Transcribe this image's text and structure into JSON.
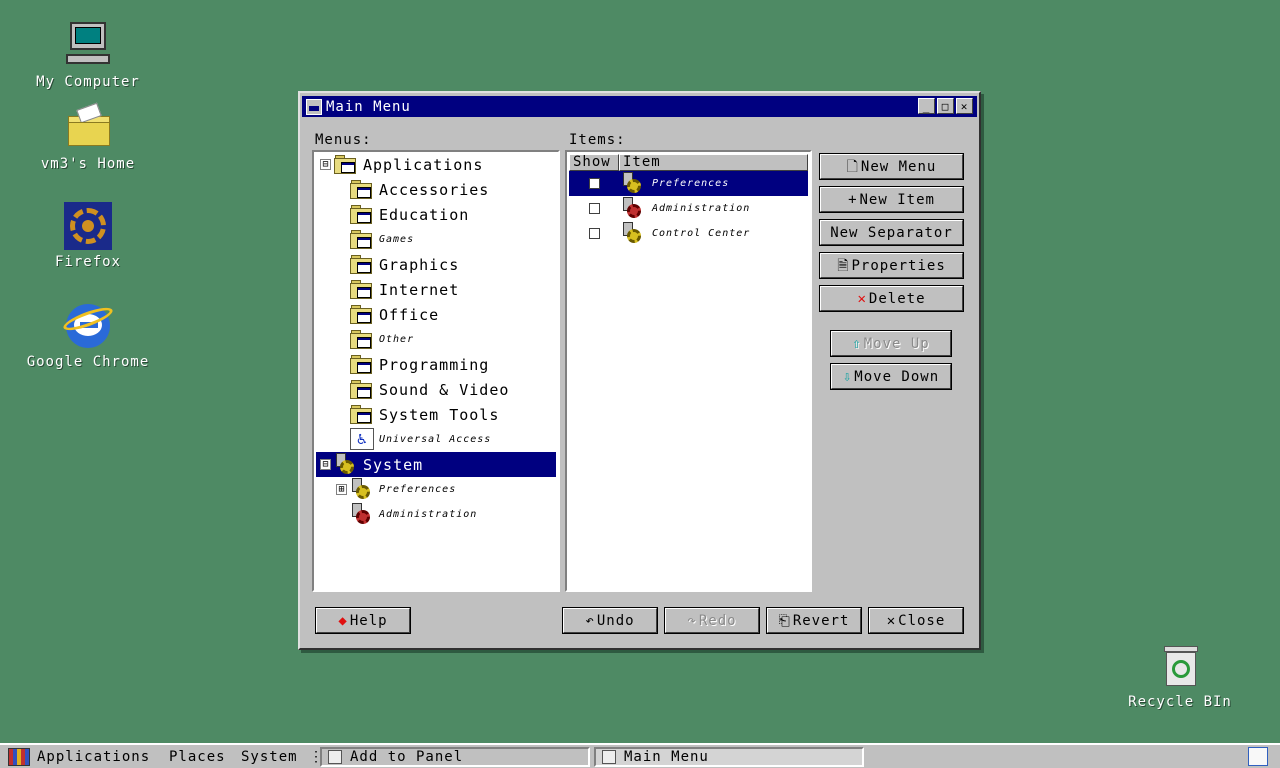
{
  "desktop": {
    "icons": [
      {
        "label": "My Computer",
        "icon": "computer-icon"
      },
      {
        "label": "vm3's Home",
        "icon": "home-folder-icon"
      },
      {
        "label": "Firefox",
        "icon": "firefox-icon"
      },
      {
        "label": "Google Chrome",
        "icon": "chrome-icon"
      },
      {
        "label": "Recycle BIn",
        "icon": "recycle-bin-icon"
      }
    ]
  },
  "window": {
    "title": "Main Menu",
    "minimize_glyph": "_",
    "maximize_glyph": "□",
    "close_glyph": "✕",
    "menus_label": "Menus:",
    "items_label": "Items:",
    "menus_tree": [
      {
        "label": "Applications",
        "size": "large",
        "icon": "folder-icon",
        "expander": "⊟"
      },
      {
        "label": "Accessories",
        "size": "large",
        "icon": "folder-icon"
      },
      {
        "label": "Education",
        "size": "large",
        "icon": "folder-icon"
      },
      {
        "label": "Games",
        "size": "small",
        "icon": "folder-icon"
      },
      {
        "label": "Graphics",
        "size": "large",
        "icon": "folder-icon"
      },
      {
        "label": "Internet",
        "size": "large",
        "icon": "folder-icon"
      },
      {
        "label": "Office",
        "size": "large",
        "icon": "folder-icon"
      },
      {
        "label": "Other",
        "size": "small",
        "icon": "folder-icon"
      },
      {
        "label": "Programming",
        "size": "large",
        "icon": "folder-icon"
      },
      {
        "label": "Sound & Video",
        "size": "large",
        "icon": "folder-icon"
      },
      {
        "label": "System Tools",
        "size": "large",
        "icon": "folder-icon"
      },
      {
        "label": "Universal Access",
        "size": "small",
        "icon": "accessibility-icon"
      },
      {
        "label": "System",
        "size": "large",
        "icon": "gear-icon",
        "expander": "⊟",
        "selected": true
      },
      {
        "label": "Preferences",
        "size": "small",
        "icon": "gear-icon",
        "expander": "⊞"
      },
      {
        "label": "Administration",
        "size": "small",
        "icon": "gear-red-icon"
      }
    ],
    "items_columns": {
      "show": "Show",
      "item": "Item"
    },
    "items": [
      {
        "label": "Preferences",
        "checked": false,
        "selected": true,
        "icon": "gear-icon"
      },
      {
        "label": "Administration",
        "checked": false,
        "selected": false,
        "icon": "gear-red-icon"
      },
      {
        "label": "Control Center",
        "checked": false,
        "selected": false,
        "icon": "gear-icon"
      }
    ],
    "buttons": {
      "new_menu": "New Menu",
      "new_item": "New Item",
      "new_separator": "New Separator",
      "properties": "Properties",
      "delete": "Delete",
      "move_up": "Move Up",
      "move_down": "Move Down",
      "help": "Help",
      "undo": "Undo",
      "redo": "Redo",
      "revert": "Revert",
      "close": "Close"
    },
    "button_icons": {
      "new_menu": "🗋",
      "new_item": "+",
      "properties": "🗎",
      "delete": "✕",
      "move_up": "⇧",
      "move_down": "⇩",
      "help": "◆",
      "undo": "↶",
      "redo": "↷",
      "revert": "⎗",
      "close": "✕"
    }
  },
  "taskbar": {
    "menus": [
      "Applications",
      "Places",
      "System"
    ],
    "tasks": [
      {
        "label": "Add to Panel",
        "pressed": false
      },
      {
        "label": "Main Menu",
        "pressed": true
      }
    ],
    "separator_glyph": "⋮"
  },
  "colors": {
    "desktop_bg": "#4e8a64",
    "title_bar": "#000080",
    "face": "#c0c0c0",
    "selection": "#000080"
  }
}
